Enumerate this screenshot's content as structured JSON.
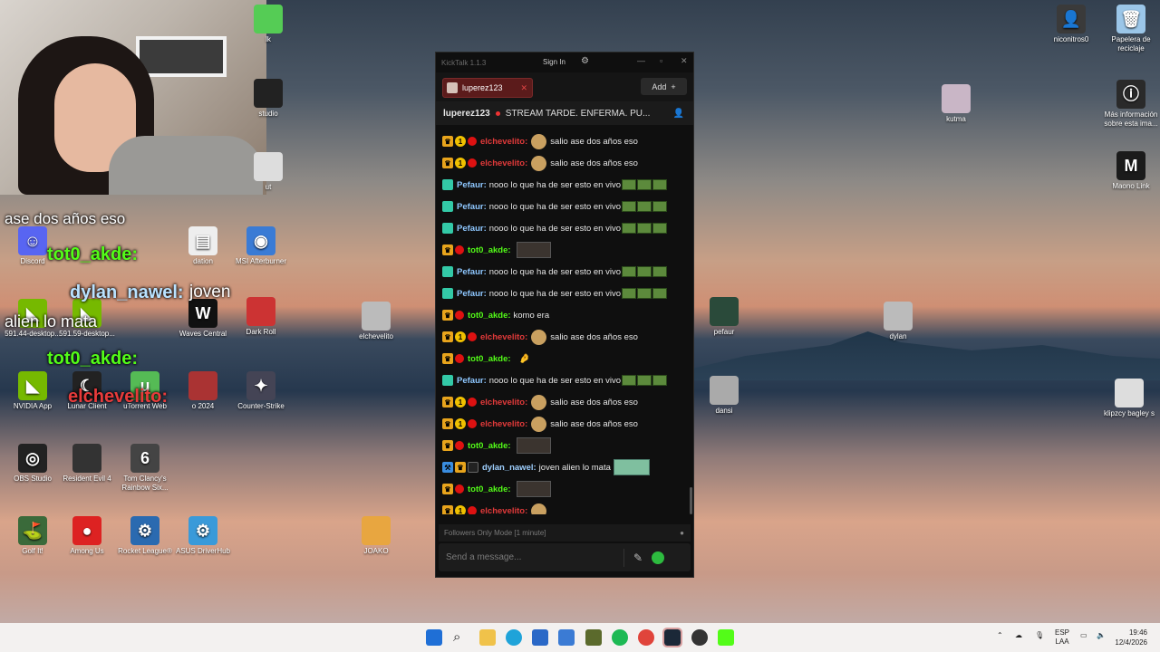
{
  "desktop_icons": [
    {
      "label": "niconitros0",
      "icon": "user-icon"
    },
    {
      "label": "Papelera de reciclaje",
      "icon": "recycle-bin-icon"
    },
    {
      "label": "kutma",
      "icon": "image-icon"
    },
    {
      "label": "Más información sobre esta ima...",
      "icon": "info-icon"
    },
    {
      "label": "Maono Link",
      "icon": "maono-icon"
    },
    {
      "label": "elchevelito",
      "icon": "image-icon"
    },
    {
      "label": "dylan",
      "icon": "image-icon"
    },
    {
      "label": "pefaur",
      "icon": "image-icon"
    },
    {
      "label": "dansi",
      "icon": "image-icon"
    },
    {
      "label": "klipzcy bagley s",
      "icon": "image-icon"
    },
    {
      "label": "MSI Afterburner",
      "icon": "msi-icon"
    },
    {
      "label": "Waves Central",
      "icon": "waves-icon"
    },
    {
      "label": "Dark Roll",
      "icon": "game-icon"
    },
    {
      "label": "Counter-Strike",
      "icon": "cs-icon"
    },
    {
      "label": "NVIDIA App",
      "icon": "nvidia-icon"
    },
    {
      "label": "Lunar Client",
      "icon": "lunar-icon"
    },
    {
      "label": "uTorrent Web",
      "icon": "utorrent-icon"
    },
    {
      "label": "OBS Studio",
      "icon": "obs-icon"
    },
    {
      "label": "Resident Evil 4",
      "icon": "game-icon"
    },
    {
      "label": "Tom Clancy's Rainbow Six...",
      "icon": "r6-icon"
    },
    {
      "label": "Golf It!",
      "icon": "golf-icon"
    },
    {
      "label": "Among Us",
      "icon": "amongus-icon"
    },
    {
      "label": "Rocket League®",
      "icon": "rocket-icon"
    },
    {
      "label": "ASUS DriverHub",
      "icon": "asus-icon"
    },
    {
      "label": "JOAKO",
      "icon": "image-icon"
    },
    {
      "label": "591.44-desktop...",
      "icon": "nvidia-icon"
    },
    {
      "label": "591.59-desktop...",
      "icon": "nvidia-icon"
    },
    {
      "label": "o 2024",
      "icon": "game-icon"
    },
    {
      "label": "Discord",
      "icon": "discord-icon"
    },
    {
      "label": "dation",
      "icon": "file-icon"
    },
    {
      "label": "studio",
      "icon": "app-icon"
    },
    {
      "label": "lk",
      "icon": "app-icon"
    },
    {
      "label": "ut",
      "icon": "app-icon"
    }
  ],
  "overlay": {
    "line1": "ase dos años eso",
    "user1": "tot0_akde:",
    "user2": "dylan_nawel:",
    "msg2": "joven",
    "line3": "alien lo mata",
    "user3": "tot0_akde:",
    "user4": "elchevelito:"
  },
  "kicktalk": {
    "title": "KickTalk 1.1.3",
    "sign_in": "Sign In",
    "tab_label": "luperez123",
    "add_label": "Add",
    "streamer": "luperez123",
    "stream_title": "STREAM TARDE. ENFERMA. PU...",
    "followers_mode": "Followers Only Mode [1 minute]",
    "input_placeholder": "Send a message..."
  },
  "chat": [
    {
      "user": "elchevelito:",
      "color": "red",
      "badges": [
        "crown",
        "one",
        "red"
      ],
      "text": "salio ase dos años eso",
      "emote": "face"
    },
    {
      "user": "elchevelito:",
      "color": "red",
      "badges": [
        "crown",
        "one",
        "red"
      ],
      "text": "salio ase dos años eso",
      "emote": "face"
    },
    {
      "user": "Pefaur:",
      "color": "blue",
      "badges": [
        "green"
      ],
      "text": "nooo lo que ha de ser esto en vivo",
      "emote": "pepe"
    },
    {
      "user": "Pefaur:",
      "color": "blue",
      "badges": [
        "green"
      ],
      "text": "nooo lo que ha de ser esto en vivo",
      "emote": "pepe"
    },
    {
      "user": "Pefaur:",
      "color": "blue",
      "badges": [
        "green"
      ],
      "text": "nooo lo que ha de ser esto en vivo",
      "emote": "pepe"
    },
    {
      "user": "tot0_akde:",
      "color": "green",
      "badges": [
        "crown",
        "red"
      ],
      "text": "",
      "emote": "wide"
    },
    {
      "user": "Pefaur:",
      "color": "blue",
      "badges": [
        "green"
      ],
      "text": "nooo lo que ha de ser esto en vivo",
      "emote": "pepe"
    },
    {
      "user": "Pefaur:",
      "color": "blue",
      "badges": [
        "green"
      ],
      "text": "nooo lo que ha de ser esto en vivo",
      "emote": "pepe"
    },
    {
      "user": "tot0_akde:",
      "color": "green",
      "badges": [
        "crown",
        "red"
      ],
      "text": "komo era",
      "emote": ""
    },
    {
      "user": "elchevelito:",
      "color": "red",
      "badges": [
        "crown",
        "one",
        "red"
      ],
      "text": "salio ase dos años eso",
      "emote": "face"
    },
    {
      "user": "tot0_akde:",
      "color": "green",
      "badges": [
        "crown",
        "red"
      ],
      "text": "",
      "emote": "small"
    },
    {
      "user": "Pefaur:",
      "color": "blue",
      "badges": [
        "green"
      ],
      "text": "nooo lo que ha de ser esto en vivo",
      "emote": "pepe"
    },
    {
      "user": "elchevelito:",
      "color": "red",
      "badges": [
        "crown",
        "one",
        "red"
      ],
      "text": "salio ase dos años eso",
      "emote": "face"
    },
    {
      "user": "elchevelito:",
      "color": "red",
      "badges": [
        "crown",
        "one",
        "red"
      ],
      "text": "salio ase dos años eso",
      "emote": "face"
    },
    {
      "user": "tot0_akde:",
      "color": "green",
      "badges": [
        "crown",
        "red"
      ],
      "text": "",
      "emote": "wide"
    },
    {
      "user": "dylan_nawel:",
      "color": "lblue",
      "badges": [
        "blue",
        "crown",
        "mask"
      ],
      "text": "joven alien lo mata",
      "emote": "alien"
    },
    {
      "user": "tot0_akde:",
      "color": "green",
      "badges": [
        "crown",
        "red"
      ],
      "text": "",
      "emote": "wide"
    },
    {
      "user": "elchevelito:",
      "color": "red",
      "badges": [
        "crown",
        "one",
        "red"
      ],
      "text": "",
      "emote": "face"
    }
  ],
  "taskbar": {
    "lang_top": "ESP",
    "lang_bottom": "LAA",
    "time": "19:46",
    "date": "12/4/2026"
  }
}
